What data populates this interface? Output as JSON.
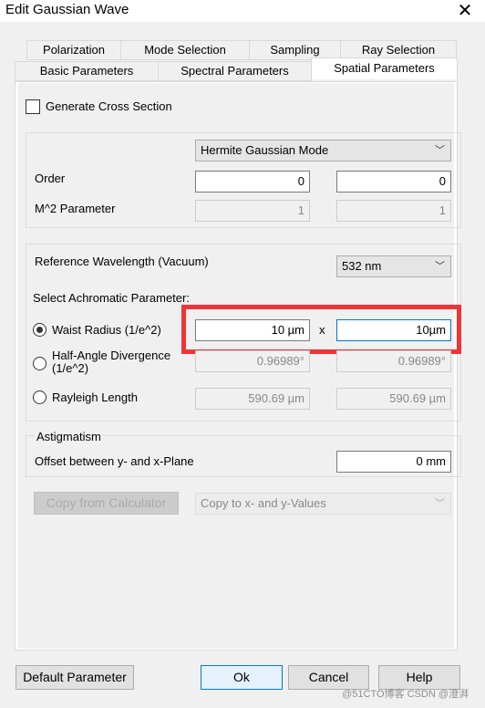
{
  "window": {
    "title": "Edit Gaussian Wave",
    "close_icon": "close-icon"
  },
  "tabs": {
    "row1": [
      "Polarization",
      "Mode Selection",
      "Sampling",
      "Ray Selection"
    ],
    "row2": [
      "Basic Parameters",
      "Spectral Parameters",
      "Spatial Parameters"
    ],
    "active": "Spatial Parameters"
  },
  "cross_section": {
    "label": "Generate Cross Section",
    "checked": false
  },
  "mode": {
    "selected": "Hermite Gaussian Mode",
    "order_label": "Order",
    "order_x": "0",
    "order_y": "0",
    "m2_label": "M^2 Parameter",
    "m2_x": "1",
    "m2_y": "1"
  },
  "wavelength": {
    "label": "Reference Wavelength (Vacuum)",
    "selected": "532 nm",
    "achromatic_label": "Select Achromatic Parameter:",
    "waist": {
      "label": "Waist Radius (1/e^2)",
      "x": "10 µm",
      "sep": "x",
      "y": "10µm",
      "selected": true
    },
    "divergence": {
      "label_line1": "Half-Angle Divergence",
      "label_line2": "(1/e^2)",
      "x": "0.96989°",
      "y": "0.96989°"
    },
    "rayleigh": {
      "label": "Rayleigh Length",
      "x": "590.69 µm",
      "y": "590.69 µm"
    }
  },
  "astigmatism": {
    "title": "Astigmatism",
    "offset_label": "Offset between y- and x-Plane",
    "offset_value": "0 mm"
  },
  "copy": {
    "calculator_button": "Copy from Calculator",
    "copy_select": "Copy to x- and y-Values"
  },
  "buttons": {
    "default": "Default Parameter",
    "ok": "Ok",
    "cancel": "Cancel",
    "help": "Help"
  },
  "watermark": "@51CTO博客 CSDN @澄湃",
  "colors": {
    "highlight": "#ef3438",
    "focus": "#0078d7"
  }
}
